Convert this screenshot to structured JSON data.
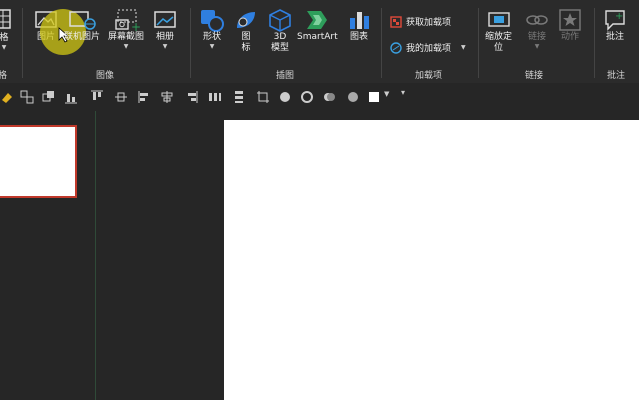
{
  "ribbon": {
    "table_partial": "格",
    "table_group_partial": "格",
    "images": {
      "picture": "图片",
      "online_picture": "联机图片",
      "screenshot": "屏幕截图",
      "album": "相册",
      "group": "图像"
    },
    "illustrations": {
      "shapes": "形状",
      "icons": "图\n标",
      "model3d": "3D\n模型",
      "smartart": "SmartArt",
      "chart": "图表",
      "group": "插图"
    },
    "addins": {
      "get": "获取加载项",
      "mine": "我的加载项",
      "group": "加载项"
    },
    "links": {
      "zoom": "缩放定\n位",
      "link": "链接",
      "action": "动作",
      "group": "链接"
    },
    "comments": {
      "comment": "批注",
      "group": "批注"
    }
  },
  "colors": {
    "ribbon_bg": "#2b2b2b",
    "accent_red": "#c0392b",
    "blue": "#2f7fe0",
    "green": "#2e9e5b"
  }
}
